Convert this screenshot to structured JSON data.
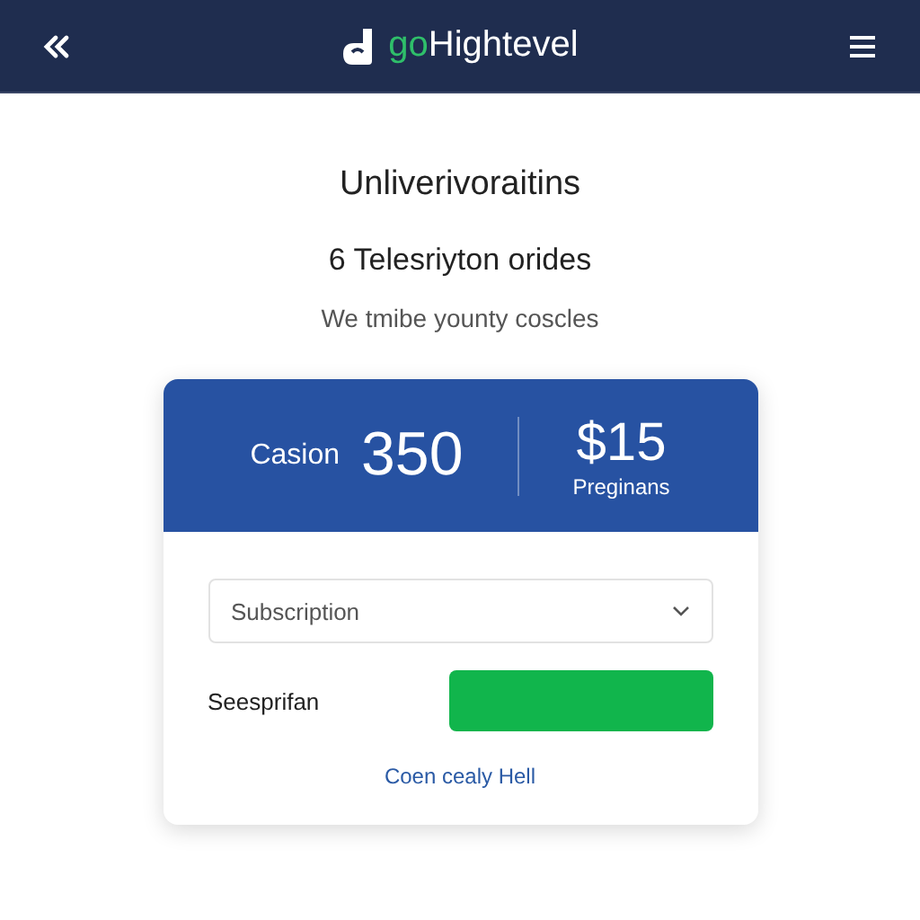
{
  "header": {
    "logo_prefix": "go",
    "logo_name": "Hightevel"
  },
  "title": "Unliverivoraitins",
  "subtitle": "6 Telesriyton orides",
  "description": "We tmibe younty coscles",
  "card": {
    "stat_label": "Casion",
    "stat_value": "350",
    "price": "$15",
    "price_label": "Preginans",
    "select": {
      "placeholder": "Subscription"
    },
    "field_label": "Seesprifan",
    "link": "Coen cealy Hell"
  }
}
